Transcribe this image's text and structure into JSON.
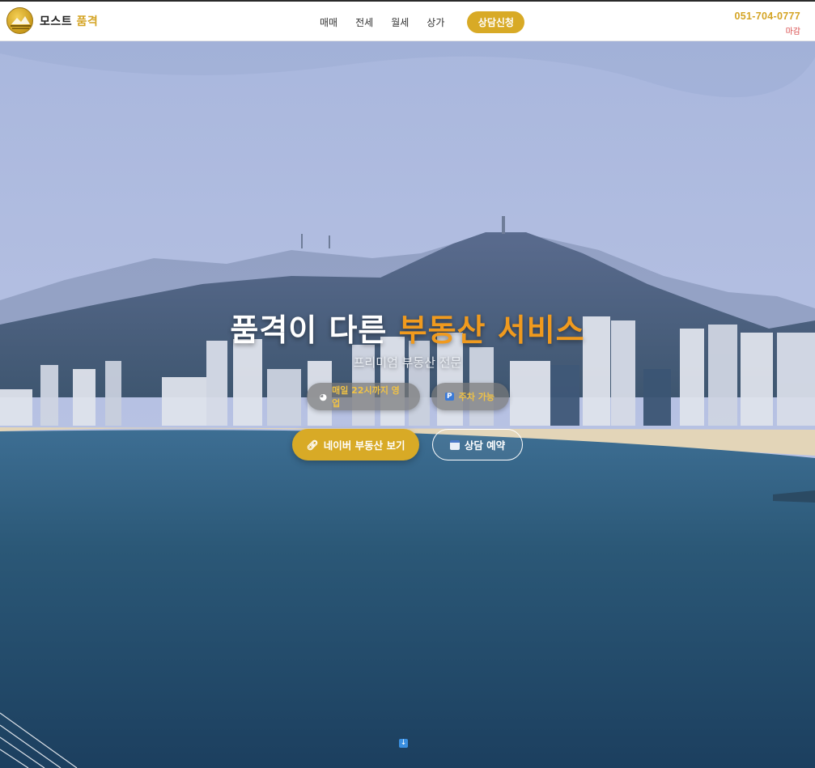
{
  "brand": {
    "name_main": "모스트",
    "name_accent": "품격"
  },
  "nav": {
    "items": [
      {
        "label": "매매"
      },
      {
        "label": "전세"
      },
      {
        "label": "월세"
      },
      {
        "label": "상가"
      }
    ],
    "cta_label": "상담신청"
  },
  "contact": {
    "phone": "051-704-0777",
    "status": "마감"
  },
  "hero": {
    "title_main": "품격이 다른",
    "title_accent": "부동산 서비스",
    "subtitle": "프리미엄 부동산 전문",
    "badges": [
      {
        "icon": "clock-icon",
        "label": "매일 22시까지 영업"
      },
      {
        "icon": "parking-icon",
        "label": "주차 가능"
      }
    ],
    "primary_button": {
      "icon": "link-icon",
      "label": "네이버 부동산 보기"
    },
    "secondary_button": {
      "icon": "calendar-icon",
      "label": "상담 예약"
    }
  },
  "colors": {
    "accent_gold": "#d8aa26",
    "accent_orange": "#f09a1e",
    "status_red": "#d84848"
  }
}
